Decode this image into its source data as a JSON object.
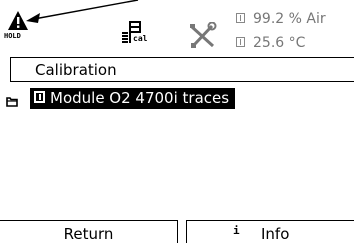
{
  "status_bar": {
    "hold_label": "HOLD",
    "cal_label": "cal",
    "measurement_1": "99.2 % Air",
    "measurement_2": "25.6 °C"
  },
  "menu": {
    "title": "Calibration",
    "items": [
      {
        "label": "Module O2 4700i  traces",
        "selected": true,
        "icon": "folder-icon"
      }
    ]
  },
  "softkeys": {
    "left_label": "Return",
    "right_glyph": "i",
    "right_label": "Info"
  },
  "colors": {
    "background": "#ffffff",
    "foreground": "#000000",
    "inactive_text": "#777777",
    "highlight_bg": "#000000",
    "highlight_fg": "#ffffff"
  }
}
